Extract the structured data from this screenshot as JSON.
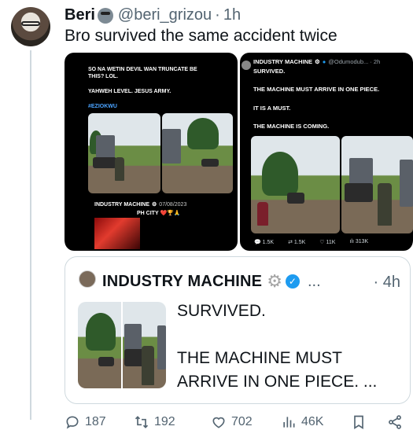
{
  "tweet": {
    "author_name": "Beri",
    "handle": "@beri_grizou",
    "separator": "·",
    "time": "1h",
    "text": "Bro survived the same accident twice"
  },
  "media": {
    "left_screenshot": {
      "line1": "SO NA WETIN DEVIL WAN TRUNCATE BE THIS? LOL.",
      "line2": "YAHWEH LEVEL. JESUS ARMY.",
      "hashtag": "#EZIOKWU",
      "embedded_author": "INDUSTRY MACHINE",
      "embedded_date": "07/08/2023",
      "embedded_text": "PH CITY",
      "emojis": "❤️🏆🙏"
    },
    "right_screenshot": {
      "author": "INDUSTRY MACHINE",
      "handle": "@Odumodub... · 2h",
      "line1": "SURVIVED.",
      "line2": "THE MACHINE MUST ARRIVE IN ONE PIECE.",
      "line3": "IT IS A MUST.",
      "line4": "THE MACHINE IS COMING.",
      "stats": {
        "replies": "1.5K",
        "reposts": "1.5K",
        "likes": "11K",
        "views": "313K"
      }
    }
  },
  "quote": {
    "author_name": "INDUSTRY MACHINE",
    "gear": "⚙",
    "more": "...",
    "time": "· 4h",
    "line1": "SURVIVED.",
    "line2": "THE MACHINE MUST",
    "line3": "ARRIVE IN ONE PIECE. ..."
  },
  "actions": {
    "replies": "187",
    "reposts": "192",
    "likes": "702",
    "views": "46K"
  },
  "colors": {
    "text": "#0f1419",
    "muted": "#536471",
    "border": "#cfd9de",
    "verified": "#1d9bf0",
    "hashtag": "#4aa3ff"
  }
}
